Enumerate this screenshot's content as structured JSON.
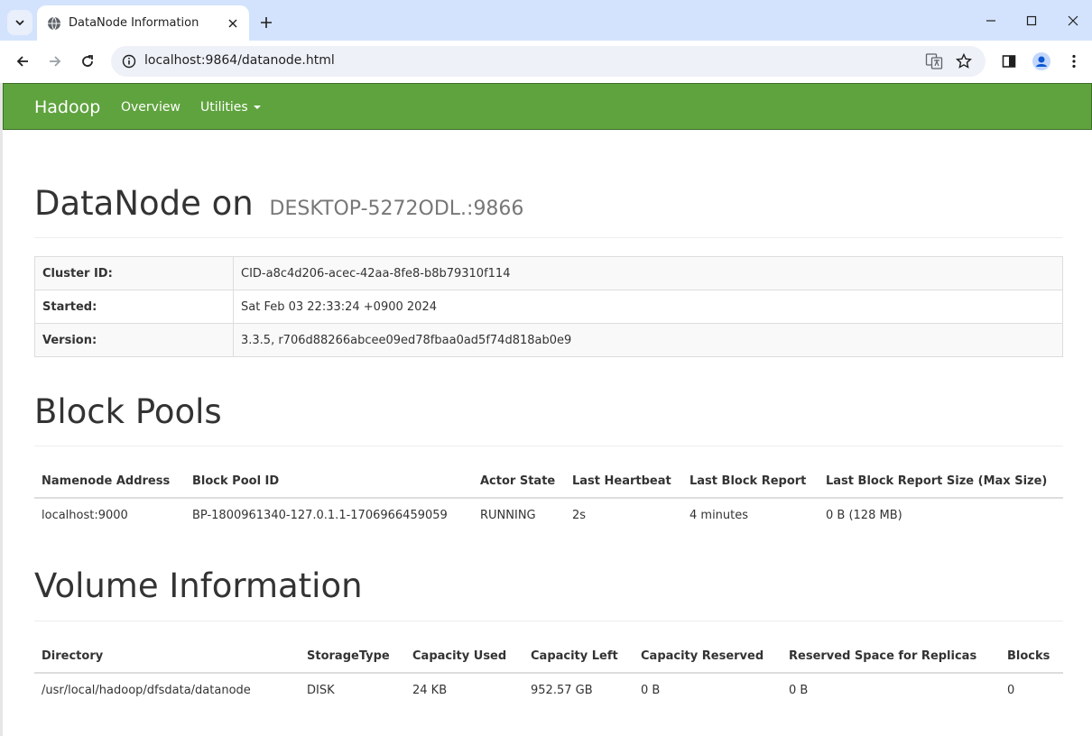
{
  "browser": {
    "tab_title": "DataNode Information",
    "url": "localhost:9864/datanode.html"
  },
  "navbar": {
    "brand": "Hadoop",
    "links": [
      "Overview",
      "Utilities"
    ]
  },
  "header": {
    "title": "DataNode on",
    "host": "DESKTOP-5272ODL.:9866"
  },
  "info": {
    "rows": [
      {
        "label": "Cluster ID:",
        "value": "CID-a8c4d206-acec-42aa-8fe8-b8b79310f114"
      },
      {
        "label": "Started:",
        "value": "Sat Feb 03 22:33:24 +0900 2024"
      },
      {
        "label": "Version:",
        "value": "3.3.5, r706d88266abcee09ed78fbaa0ad5f74d818ab0e9"
      }
    ]
  },
  "block_pools": {
    "title": "Block Pools",
    "columns": [
      "Namenode Address",
      "Block Pool ID",
      "Actor State",
      "Last Heartbeat",
      "Last Block Report",
      "Last Block Report Size (Max Size)"
    ],
    "rows": [
      [
        "localhost:9000",
        "BP-1800961340-127.0.1.1-1706966459059",
        "RUNNING",
        "2s",
        "4 minutes",
        "0 B (128 MB)"
      ]
    ]
  },
  "volumes": {
    "title": "Volume Information",
    "columns": [
      "Directory",
      "StorageType",
      "Capacity Used",
      "Capacity Left",
      "Capacity Reserved",
      "Reserved Space for Replicas",
      "Blocks"
    ],
    "rows": [
      [
        "/usr/local/hadoop/dfsdata/datanode",
        "DISK",
        "24 KB",
        "952.57 GB",
        "0 B",
        "0 B",
        "0"
      ]
    ]
  }
}
